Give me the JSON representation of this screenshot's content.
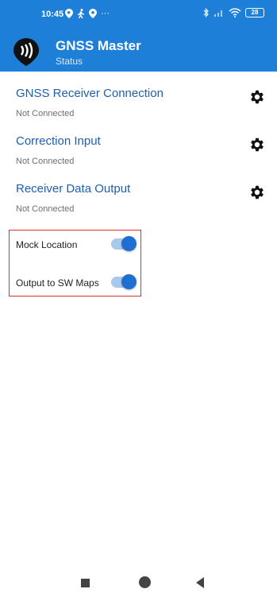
{
  "status_bar": {
    "time": "10:45",
    "left_icons": [
      "location-icon",
      "walking-icon",
      "app-icon",
      "more-icon"
    ],
    "more_glyph": "···",
    "right_icons": [
      "bluetooth-icon",
      "signal-icon",
      "wifi-icon",
      "battery-icon"
    ],
    "battery": "28"
  },
  "header": {
    "title": "GNSS Master",
    "subtitle": "Status",
    "color": "#1e7fd8"
  },
  "sections": [
    {
      "title": "GNSS Receiver Connection",
      "status": "Not Connected",
      "icon": "gear-icon"
    },
    {
      "title": "Correction Input",
      "status": "Not Connected",
      "icon": "gear-icon"
    },
    {
      "title": "Receiver Data Output",
      "status": "Not Connected",
      "icon": "gear-icon"
    }
  ],
  "toggles": [
    {
      "label": "Mock Location",
      "on": true
    },
    {
      "label": "Output to SW Maps",
      "on": true
    }
  ],
  "colors": {
    "accent": "#1f6fd0",
    "link_text": "#1f5fae",
    "highlight_border": "#d9302c"
  },
  "navbar": {
    "icons": [
      "recents-icon",
      "home-icon",
      "back-icon"
    ]
  }
}
